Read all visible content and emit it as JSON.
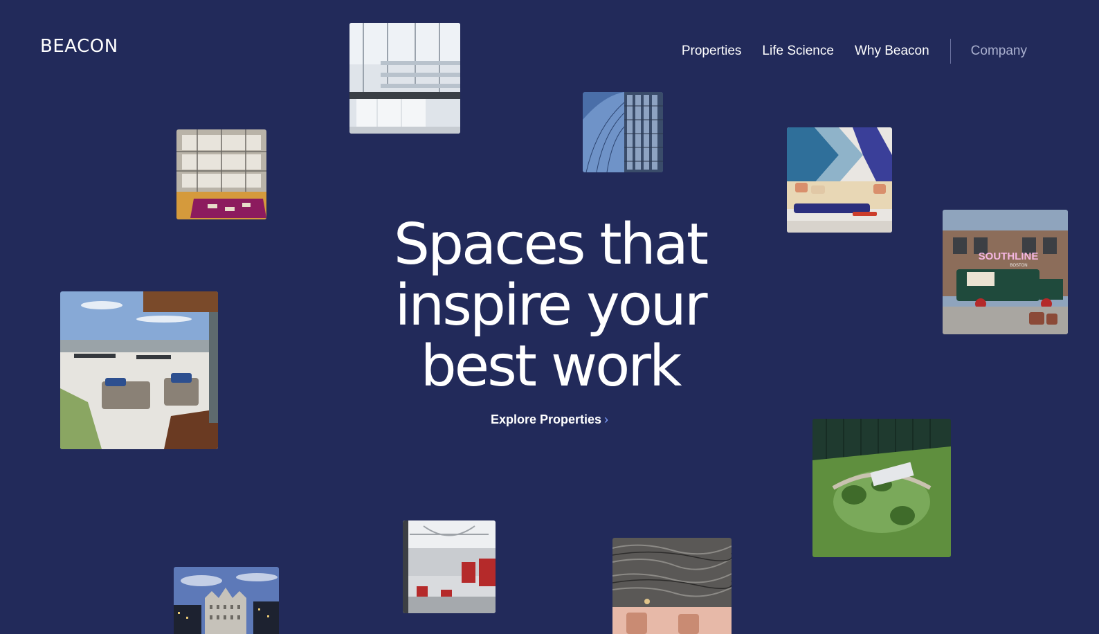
{
  "header": {
    "logo": "BEACON",
    "nav": {
      "properties": "Properties",
      "life_science": "Life Science",
      "why_beacon": "Why Beacon",
      "company": "Company"
    }
  },
  "hero": {
    "headline_lines": [
      "Spaces that",
      "inspire your",
      "best work"
    ],
    "cta_label": "Explore Properties",
    "cta_icon": "chevron-right-icon"
  },
  "photos": {
    "truck_sign": "SOUTHLINE",
    "truck_sign_sub": "BOSTON"
  },
  "colors": {
    "background": "#222a5a",
    "text": "#ffffff",
    "muted_nav": "#aab0cf",
    "accent": "#7fa0ff"
  }
}
